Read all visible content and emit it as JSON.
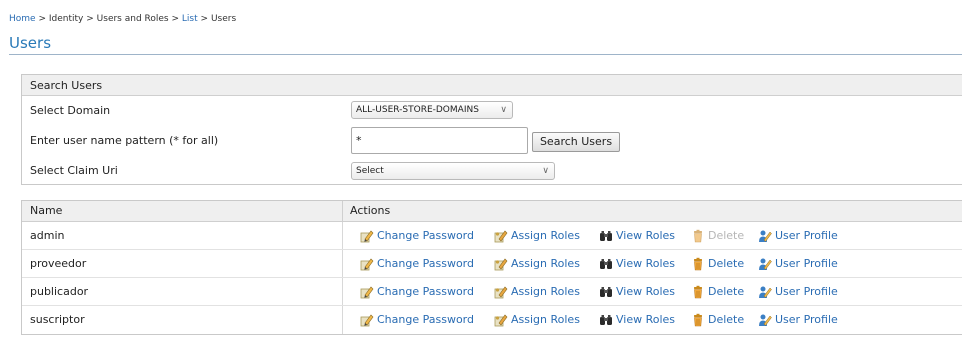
{
  "breadcrumb": {
    "home": "Home",
    "sep": ">",
    "identity": "Identity",
    "users_roles": "Users and Roles",
    "list": "List",
    "users": "Users"
  },
  "page_title": "Users",
  "search": {
    "header": "Search Users",
    "domain_label": "Select Domain",
    "domain_value": "ALL-USER-STORE-DOMAINS",
    "pattern_label": "Enter user name pattern (* for all)",
    "pattern_value": "*",
    "search_button": "Search Users",
    "claim_label": "Select Claim Uri",
    "claim_value": "Select"
  },
  "table": {
    "col_name": "Name",
    "col_actions": "Actions",
    "actions": {
      "change_password": "Change Password",
      "assign_roles": "Assign Roles",
      "view_roles": "View Roles",
      "delete": "Delete",
      "user_profile": "User Profile"
    },
    "rows": [
      {
        "name": "admin",
        "delete_enabled": false
      },
      {
        "name": "proveedor",
        "delete_enabled": true
      },
      {
        "name": "publicador",
        "delete_enabled": true
      },
      {
        "name": "suscriptor",
        "delete_enabled": true
      }
    ]
  },
  "colors": {
    "link": "#2a6cb3",
    "title": "#2a7ab8",
    "disabled": "#b6b6b6"
  }
}
